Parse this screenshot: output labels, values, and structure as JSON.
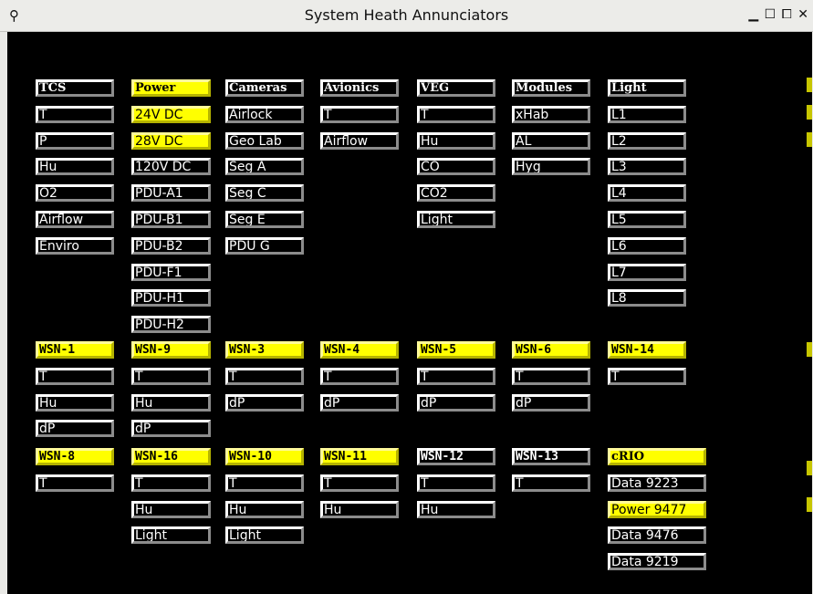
{
  "window": {
    "title": "System Heath Annunciators",
    "icon": "binoculars-icon",
    "controls": {
      "minimize": "▁",
      "maximize": "☐",
      "restore": "⧠",
      "close": "✕"
    }
  },
  "colors": {
    "active": "#ffff00",
    "inactive": "#000000",
    "text_on_dark": "#ffffff",
    "text_on_active": "#000000",
    "background": "#000000"
  },
  "groups": [
    {
      "title": "TCS",
      "header_on": false,
      "items": [
        {
          "label": "T",
          "on": false
        },
        {
          "label": "P",
          "on": false
        },
        {
          "label": "Hu",
          "on": false
        },
        {
          "label": "O2",
          "on": false
        },
        {
          "label": "Airflow",
          "on": false
        },
        {
          "label": "Enviro",
          "on": false
        }
      ]
    },
    {
      "title": "Power",
      "header_on": true,
      "items": [
        {
          "label": "24V DC",
          "on": true
        },
        {
          "label": "28V DC",
          "on": true
        },
        {
          "label": "120V DC",
          "on": false
        },
        {
          "label": "PDU-A1",
          "on": false
        },
        {
          "label": "PDU-B1",
          "on": false
        },
        {
          "label": "PDU-B2",
          "on": false
        },
        {
          "label": "PDU-F1",
          "on": false
        },
        {
          "label": "PDU-H1",
          "on": false
        },
        {
          "label": "PDU-H2",
          "on": false
        }
      ]
    },
    {
      "title": "Cameras",
      "header_on": false,
      "items": [
        {
          "label": "Airlock",
          "on": false
        },
        {
          "label": "Geo Lab",
          "on": false
        },
        {
          "label": "Seg A",
          "on": false
        },
        {
          "label": "Seg C",
          "on": false
        },
        {
          "label": "Seg E",
          "on": false
        },
        {
          "label": "PDU G",
          "on": false
        }
      ]
    },
    {
      "title": "Avionics",
      "header_on": false,
      "items": [
        {
          "label": "T",
          "on": false
        },
        {
          "label": "Airflow",
          "on": false
        }
      ]
    },
    {
      "title": "VEG",
      "header_on": false,
      "items": [
        {
          "label": "T",
          "on": false
        },
        {
          "label": "Hu",
          "on": false
        },
        {
          "label": "CO",
          "on": false
        },
        {
          "label": "CO2",
          "on": false
        },
        {
          "label": "Light",
          "on": false
        }
      ]
    },
    {
      "title": "Modules",
      "header_on": false,
      "items": [
        {
          "label": "xHab",
          "on": false
        },
        {
          "label": "AL",
          "on": false
        },
        {
          "label": "Hyg",
          "on": false
        }
      ]
    },
    {
      "title": "Light",
      "header_on": false,
      "items": [
        {
          "label": "L1",
          "on": false
        },
        {
          "label": "L2",
          "on": false
        },
        {
          "label": "L3",
          "on": false
        },
        {
          "label": "L4",
          "on": false
        },
        {
          "label": "L5",
          "on": false
        },
        {
          "label": "L6",
          "on": false
        },
        {
          "label": "L7",
          "on": false
        },
        {
          "label": "L8",
          "on": false
        }
      ]
    },
    {
      "title": "WSN-1",
      "header_on": true,
      "items": [
        {
          "label": "T",
          "on": false
        },
        {
          "label": "Hu",
          "on": false
        },
        {
          "label": "dP",
          "on": false
        }
      ]
    },
    {
      "title": "WSN-9",
      "header_on": true,
      "items": [
        {
          "label": "T",
          "on": false
        },
        {
          "label": "Hu",
          "on": false
        },
        {
          "label": "dP",
          "on": false
        }
      ]
    },
    {
      "title": "WSN-3",
      "header_on": true,
      "items": [
        {
          "label": "T",
          "on": false
        },
        {
          "label": "dP",
          "on": false
        }
      ]
    },
    {
      "title": "WSN-4",
      "header_on": true,
      "items": [
        {
          "label": "T",
          "on": false
        },
        {
          "label": "dP",
          "on": false
        }
      ]
    },
    {
      "title": "WSN-5",
      "header_on": true,
      "items": [
        {
          "label": "T",
          "on": false
        },
        {
          "label": "dP",
          "on": false
        }
      ]
    },
    {
      "title": "WSN-6",
      "header_on": true,
      "items": [
        {
          "label": "T",
          "on": false
        },
        {
          "label": "dP",
          "on": false
        }
      ]
    },
    {
      "title": "WSN-14",
      "header_on": true,
      "items": [
        {
          "label": "T",
          "on": false
        }
      ]
    },
    {
      "title": "WSN-8",
      "header_on": true,
      "items": [
        {
          "label": "T",
          "on": false
        }
      ]
    },
    {
      "title": "WSN-16",
      "header_on": true,
      "items": [
        {
          "label": "T",
          "on": false
        },
        {
          "label": "Hu",
          "on": false
        },
        {
          "label": "Light",
          "on": false
        }
      ]
    },
    {
      "title": "WSN-10",
      "header_on": true,
      "items": [
        {
          "label": "T",
          "on": false
        },
        {
          "label": "Hu",
          "on": false
        },
        {
          "label": "Light",
          "on": false
        }
      ]
    },
    {
      "title": "WSN-11",
      "header_on": true,
      "items": [
        {
          "label": "T",
          "on": false
        },
        {
          "label": "Hu",
          "on": false
        }
      ]
    },
    {
      "title": "WSN-12",
      "header_on": false,
      "items": [
        {
          "label": "T",
          "on": false
        },
        {
          "label": "Hu",
          "on": false
        }
      ]
    },
    {
      "title": "WSN-13",
      "header_on": false,
      "items": [
        {
          "label": "T",
          "on": false
        }
      ]
    },
    {
      "title": "cRIO",
      "header_on": true,
      "items": [
        {
          "label": "Data 9223",
          "on": false
        },
        {
          "label": "Power 9477",
          "on": true
        },
        {
          "label": "Data 9476",
          "on": false
        },
        {
          "label": "Data 9219",
          "on": false
        }
      ]
    }
  ]
}
